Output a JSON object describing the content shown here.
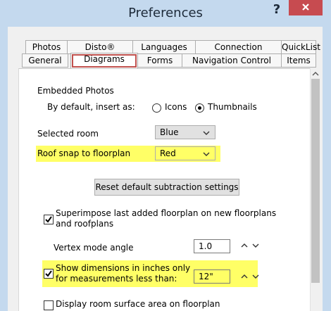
{
  "window": {
    "title": "Preferences",
    "help_label": "?",
    "close_label": "×"
  },
  "tabs": {
    "row1": [
      "Photos",
      "Disto®",
      "Languages",
      "Connection",
      "QuickList"
    ],
    "row2": [
      "General",
      "Diagrams",
      "Forms",
      "Navigation Control",
      "Items"
    ],
    "active": "Diagrams"
  },
  "embedded_photos": {
    "section_label": "Embedded Photos",
    "insert_label": "By default, insert as:",
    "options": [
      "Icons",
      "Thumbnails"
    ],
    "selected": "Thumbnails"
  },
  "selected_room": {
    "label": "Selected room",
    "value": "Blue"
  },
  "roof_snap": {
    "label": "Roof snap to floorplan",
    "value": "Red"
  },
  "reset_button": {
    "label": "Reset default subtraction settings"
  },
  "superimpose": {
    "label_line1": "Superimpose last added floorplan on new floorplans",
    "label_line2": "and roofplans",
    "checked": true
  },
  "vertex": {
    "label": "Vertex mode angle",
    "value": "1.0"
  },
  "show_dimensions": {
    "label_line1": "Show dimensions in inches only",
    "label_line2": "for measurements less than:",
    "value": "12\"",
    "checked": true
  },
  "display_area": {
    "label": "Display room surface area on floorplan",
    "checked": false
  },
  "icons": {
    "dropdown": "chevron-down-icon",
    "spin_up": "chevron-up-icon",
    "spin_down": "chevron-down-icon",
    "checkmark": "check-icon",
    "scroll_up": "chevron-up-icon"
  },
  "colors": {
    "titlebar": "#c4d9ee",
    "close": "#c74b50",
    "highlight": "#ffff66",
    "active_tab_outline": "#c0504d"
  }
}
